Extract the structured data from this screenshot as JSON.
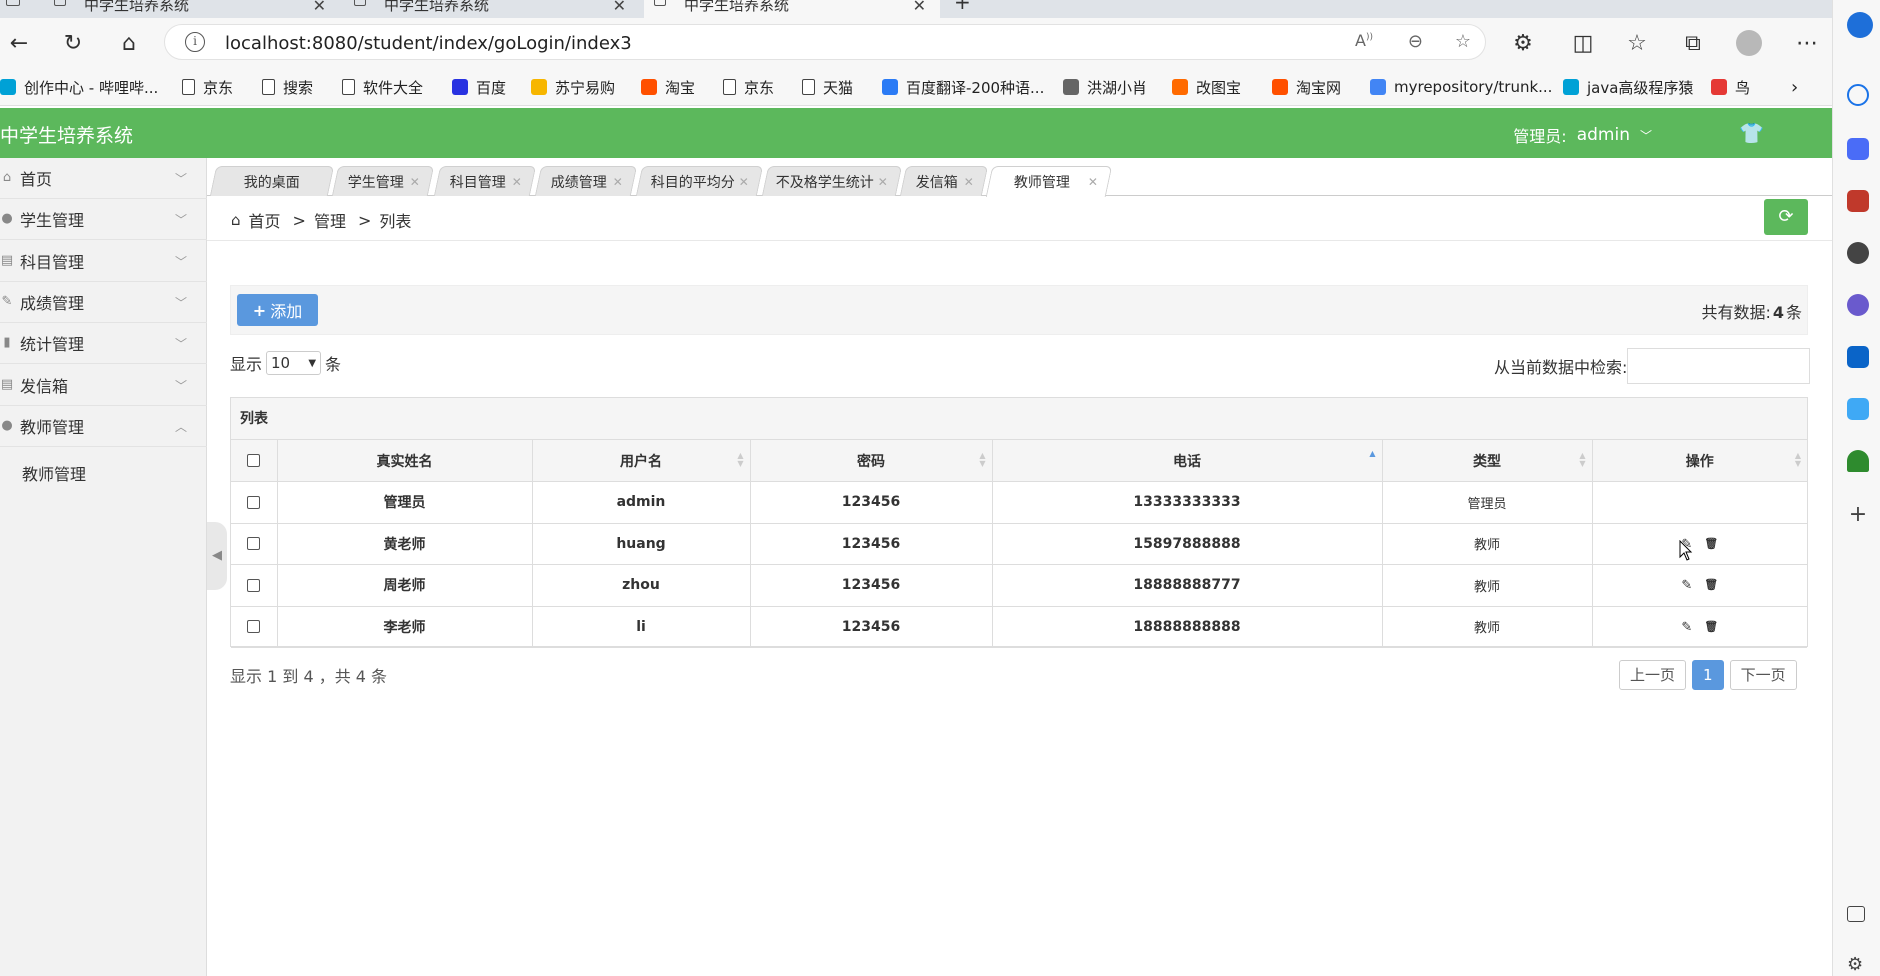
{
  "browser": {
    "tabs": [
      {
        "title": "中学生培养系统"
      },
      {
        "title": "中学生培养系统"
      },
      {
        "title": "中学生培养系统",
        "active": true
      }
    ],
    "url": "localhost:8080/student/index/goLogin/index3",
    "bookmarks": [
      {
        "label": "创作中心 - 哔哩哔...",
        "icon": "bilibili-icon",
        "color": "#00a1d6"
      },
      {
        "label": "京东",
        "icon": "page-icon"
      },
      {
        "label": "搜索",
        "icon": "page-icon"
      },
      {
        "label": "软件大全",
        "icon": "page-icon"
      },
      {
        "label": "百度",
        "icon": "baidu-icon",
        "color": "#2932e1"
      },
      {
        "label": "苏宁易购",
        "icon": "suning-icon",
        "color": "#f7b600"
      },
      {
        "label": "淘宝",
        "icon": "taobao-icon",
        "color": "#ff5000"
      },
      {
        "label": "京东",
        "icon": "page-icon"
      },
      {
        "label": "天猫",
        "icon": "page-icon"
      },
      {
        "label": "百度翻译-200种语...",
        "icon": "translate-icon",
        "color": "#2b7bf5"
      },
      {
        "label": "洪湖小肖",
        "icon": "hawk-icon",
        "color": "#666666"
      },
      {
        "label": "改图宝",
        "icon": "gaitubao-icon",
        "color": "#ff6a00"
      },
      {
        "label": "淘宝网",
        "icon": "taobao-icon",
        "color": "#ff5000"
      },
      {
        "label": "myrepository/trunk...",
        "icon": "chrome-icon",
        "color": "#4285f4"
      },
      {
        "label": "java高级程序猿",
        "icon": "bilibili-icon",
        "color": "#00a1d6"
      },
      {
        "label": "鸟",
        "icon": "bird-icon",
        "color": "#e53935"
      }
    ]
  },
  "app": {
    "title": "中学生培养系统",
    "admin_label": "管理员:",
    "admin_name": "admin",
    "accent": "#5cb85c",
    "primary": "#5a98de"
  },
  "menu": {
    "items": [
      {
        "label": "首页",
        "icon": "home-icon",
        "expanded": false
      },
      {
        "label": "学生管理",
        "icon": "user-icon",
        "expanded": false
      },
      {
        "label": "科目管理",
        "icon": "list-icon",
        "expanded": false
      },
      {
        "label": "成绩管理",
        "icon": "edit-icon",
        "expanded": false
      },
      {
        "label": "统计管理",
        "icon": "chart-icon",
        "expanded": false
      },
      {
        "label": "发信箱",
        "icon": "list-icon",
        "expanded": false
      },
      {
        "label": "教师管理",
        "icon": "user-icon",
        "expanded": true
      }
    ],
    "sub_items": [
      {
        "label": "教师管理"
      }
    ]
  },
  "content_tabs": [
    {
      "label": "我的桌面",
      "closable": false
    },
    {
      "label": "学生管理",
      "closable": true
    },
    {
      "label": "科目管理",
      "closable": true
    },
    {
      "label": "成绩管理",
      "closable": true
    },
    {
      "label": "科目的平均分",
      "closable": true
    },
    {
      "label": "不及格学生统计",
      "closable": true
    },
    {
      "label": "发信箱",
      "closable": true
    },
    {
      "label": "教师管理",
      "closable": true,
      "active": true
    }
  ],
  "breadcrumb": {
    "home": "首页",
    "sep": ">",
    "level1": "管理",
    "level2": "列表"
  },
  "toolbar": {
    "add_label": "添加",
    "total_prefix": "共有数据:",
    "total_count": "4",
    "total_suffix": "条"
  },
  "list_controls": {
    "show_label": "显示",
    "page_len": "10",
    "unit": "条",
    "search_label": "从当前数据中检索:"
  },
  "table": {
    "caption": "列表",
    "columns": [
      "真实姓名",
      "用户名",
      "密码",
      "电话",
      "类型",
      "操作"
    ],
    "rows": [
      {
        "name": "管理员",
        "username": "admin",
        "password": "123456",
        "phone": "13333333333",
        "type": "管理员",
        "actions": false
      },
      {
        "name": "黄老师",
        "username": "huang",
        "password": "123456",
        "phone": "15897888888",
        "type": "教师",
        "actions": true
      },
      {
        "name": "周老师",
        "username": "zhou",
        "password": "123456",
        "phone": "18888888777",
        "type": "教师",
        "actions": true
      },
      {
        "name": "李老师",
        "username": "li",
        "password": "123456",
        "phone": "18888888888",
        "type": "教师",
        "actions": true
      }
    ]
  },
  "footer": {
    "info": "显示 1 到 4 ，共 4 条",
    "prev": "上一页",
    "current_page": "1",
    "next": "下一页"
  }
}
